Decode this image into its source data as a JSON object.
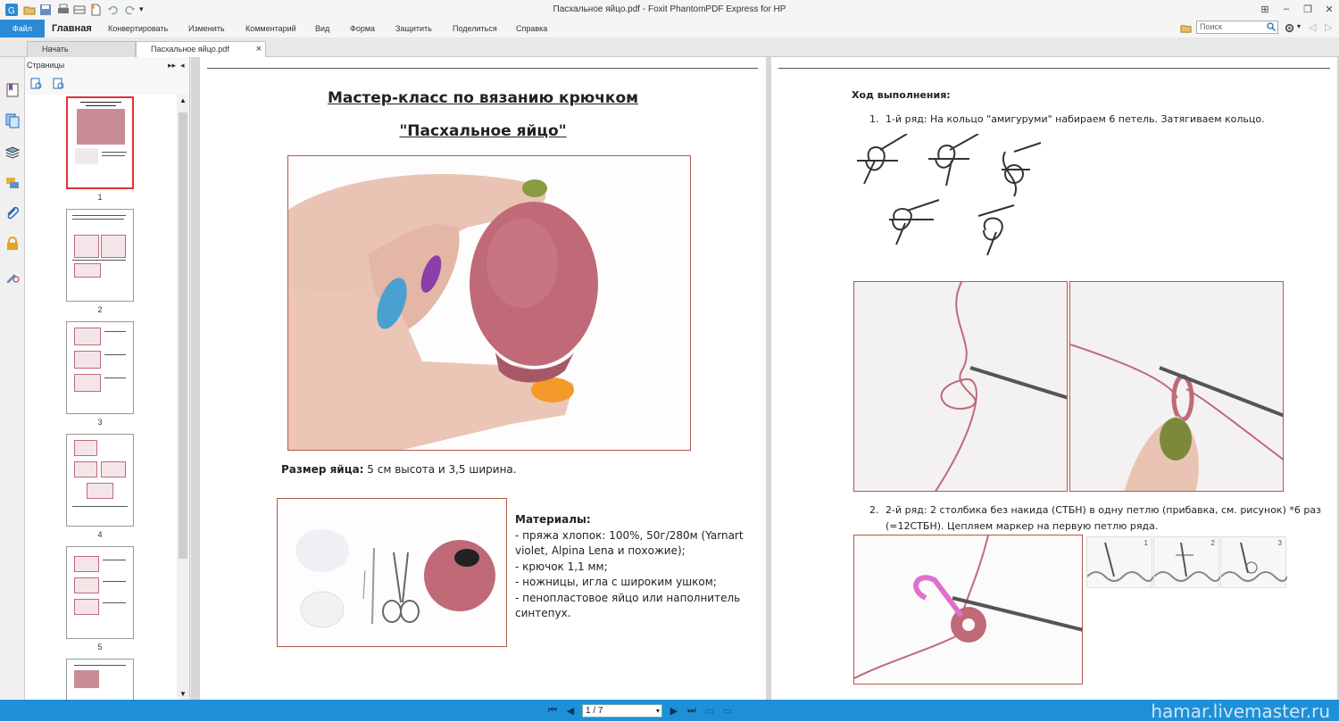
{
  "window": {
    "title": "Пасхальное яйцо.pdf - Foxit PhantomPDF Express for HP"
  },
  "ribbon": {
    "tabs": [
      "Файл",
      "Главная",
      "Конвертировать",
      "Изменить",
      "Комментарий",
      "Вид",
      "Форма",
      "Защитить",
      "Поделиться",
      "Справка"
    ],
    "search_placeholder": "Поиск"
  },
  "doc_tabs": {
    "start": "Начать",
    "document": "Пасхальное яйцо.pdf",
    "close": "×"
  },
  "pages_panel": {
    "title": "Страницы",
    "thumb_numbers": [
      "1",
      "2",
      "3",
      "4",
      "5"
    ],
    "selected": 1
  },
  "page1": {
    "title1": "Мастер-класс по вязанию крючком",
    "title2": "\"Пасхальное яйцо\"",
    "size_label": "Размер яйца:",
    "size_text": " 5 см высота и 3,5 ширина.",
    "materials_title": "Материалы:",
    "materials": [
      "- пряжа хлопок: 100%, 50г/280м (Yarnart",
      "violet, Alpina Lena и похожие);",
      "- крючок 1,1 мм;",
      "- ножницы, игла с широким ушком;",
      "- пенопластовое яйцо или наполнитель",
      "синтепух."
    ]
  },
  "page2": {
    "heading": "Ход выполнения:",
    "step1_num": "1.",
    "step1": "1-й ряд: На кольцо \"амигуруми\" набираем 6 петель. Затягиваем кольцо.",
    "step2_num": "2.",
    "step2_line1": "2-й ряд:  2 столбика без накида (СТБН) в одну петлю (прибавка, см. рисунок) *6 раз",
    "step2_line2": "(=12СТБН). Цепляем маркер на первую петлю ряда.",
    "diagram_numbers": [
      "1",
      "2",
      "3"
    ]
  },
  "statusbar": {
    "page_value": "1 / 7",
    "watermark": "hamar.livemaster.ru"
  },
  "colors": {
    "accent": "#1e90d8",
    "file_tab": "#2a8ad4",
    "photo_border": "#b05a4a",
    "yarn": "#c06a78"
  }
}
